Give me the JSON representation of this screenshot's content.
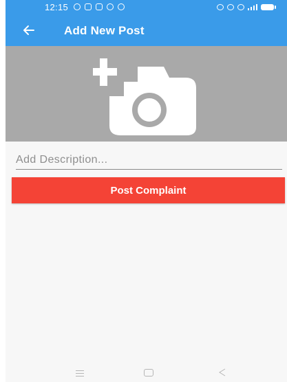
{
  "status_bar": {
    "time": "12:15"
  },
  "app_bar": {
    "title": "Add New Post",
    "back_icon": "arrow-left-icon"
  },
  "image_picker": {
    "icon": "add-a-photo-icon"
  },
  "description": {
    "placeholder": "Add Description...",
    "value": ""
  },
  "post_button": {
    "label": "Post Complaint"
  },
  "colors": {
    "primary": "#3a9be9",
    "accent": "#f44336",
    "image_bg": "#a9a9a9"
  },
  "nav_bar": {
    "icons": [
      "menu-icon",
      "home-icon",
      "back-triangle-icon"
    ]
  }
}
